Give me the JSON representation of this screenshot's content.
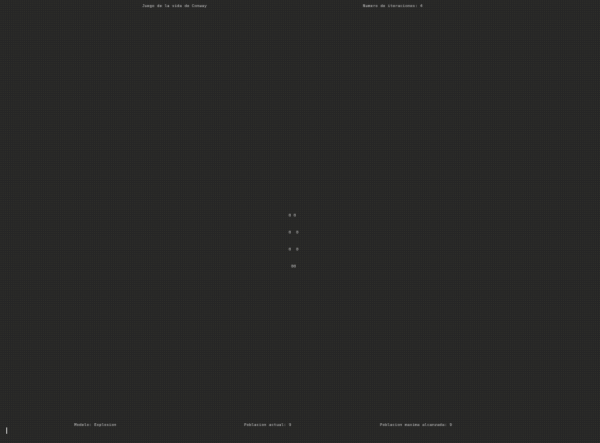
{
  "header": {
    "title": "Juego de la vida de Conway",
    "iterations": "Numero de iteraciones: 4"
  },
  "board": {
    "rows": [
      "0 0",
      "0  0",
      "0  0",
      " 00"
    ]
  },
  "footer": {
    "model": "Modelo: Explosion",
    "population_current": "Poblacion actual: 9",
    "population_max": "Poblacion maxima alcanzada: 9"
  },
  "colors": {
    "background": "#262626",
    "text": "#cfcfcf"
  }
}
